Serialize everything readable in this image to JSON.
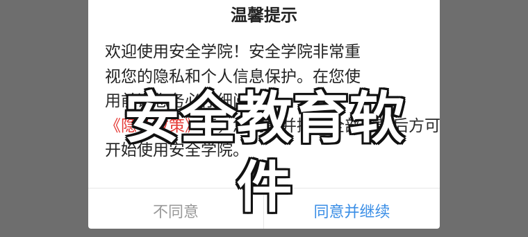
{
  "dialog": {
    "title": "温馨提示",
    "lines": [
      "欢迎使用安全学院！安全学院非常重",
      "视您的隐私和个人信息保护。在您使",
      "用前请您务必仔细阅读",
      "等，您同意并接受全部条款后方可",
      "开始使用安全学院。"
    ],
    "link_text": "《隐私政策》",
    "buttons": {
      "disagree": "不同意",
      "agree": "同意并继续"
    }
  },
  "watermark": "安全教育软件",
  "colors": {
    "backdrop": "#6e6e6e",
    "link": "#e53935",
    "agree": "#3a8ee6",
    "disagree": "#999999"
  }
}
